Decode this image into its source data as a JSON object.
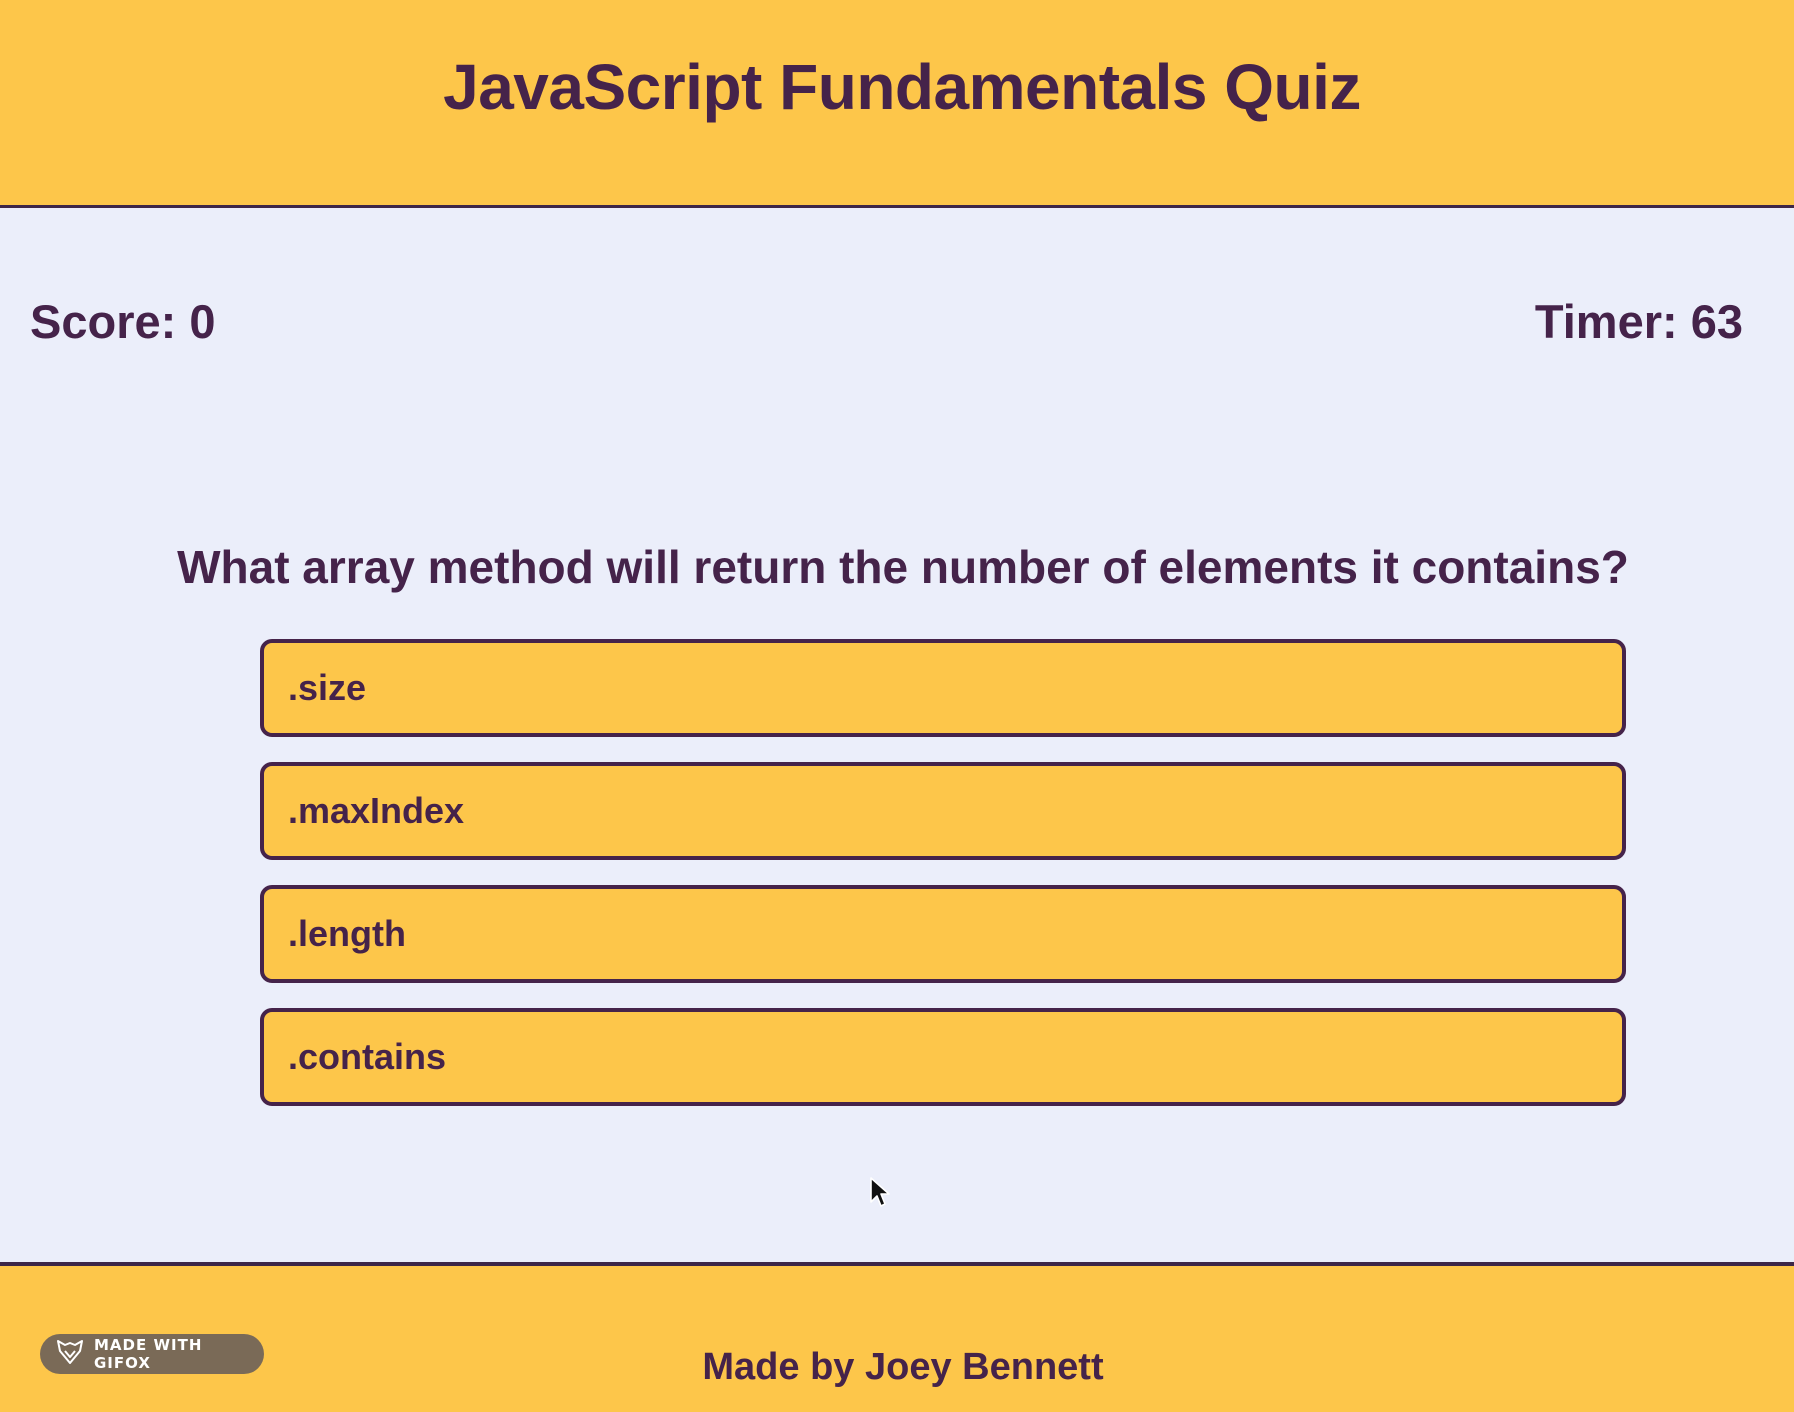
{
  "header": {
    "title": "JavaScript Fundamentals Quiz"
  },
  "stats": {
    "score": "Score: 0",
    "timer": "Timer: 63"
  },
  "quiz": {
    "question": "What array method will return the number of elements it contains?",
    "answers": [
      ".size",
      ".maxIndex",
      ".length",
      ".contains"
    ]
  },
  "footer": {
    "credit": "Made by Joey Bennett",
    "badge": "MADE WITH GIFOX"
  },
  "colors": {
    "accent": "#fdc64a",
    "text": "#45234a",
    "background": "#ebeefa"
  }
}
